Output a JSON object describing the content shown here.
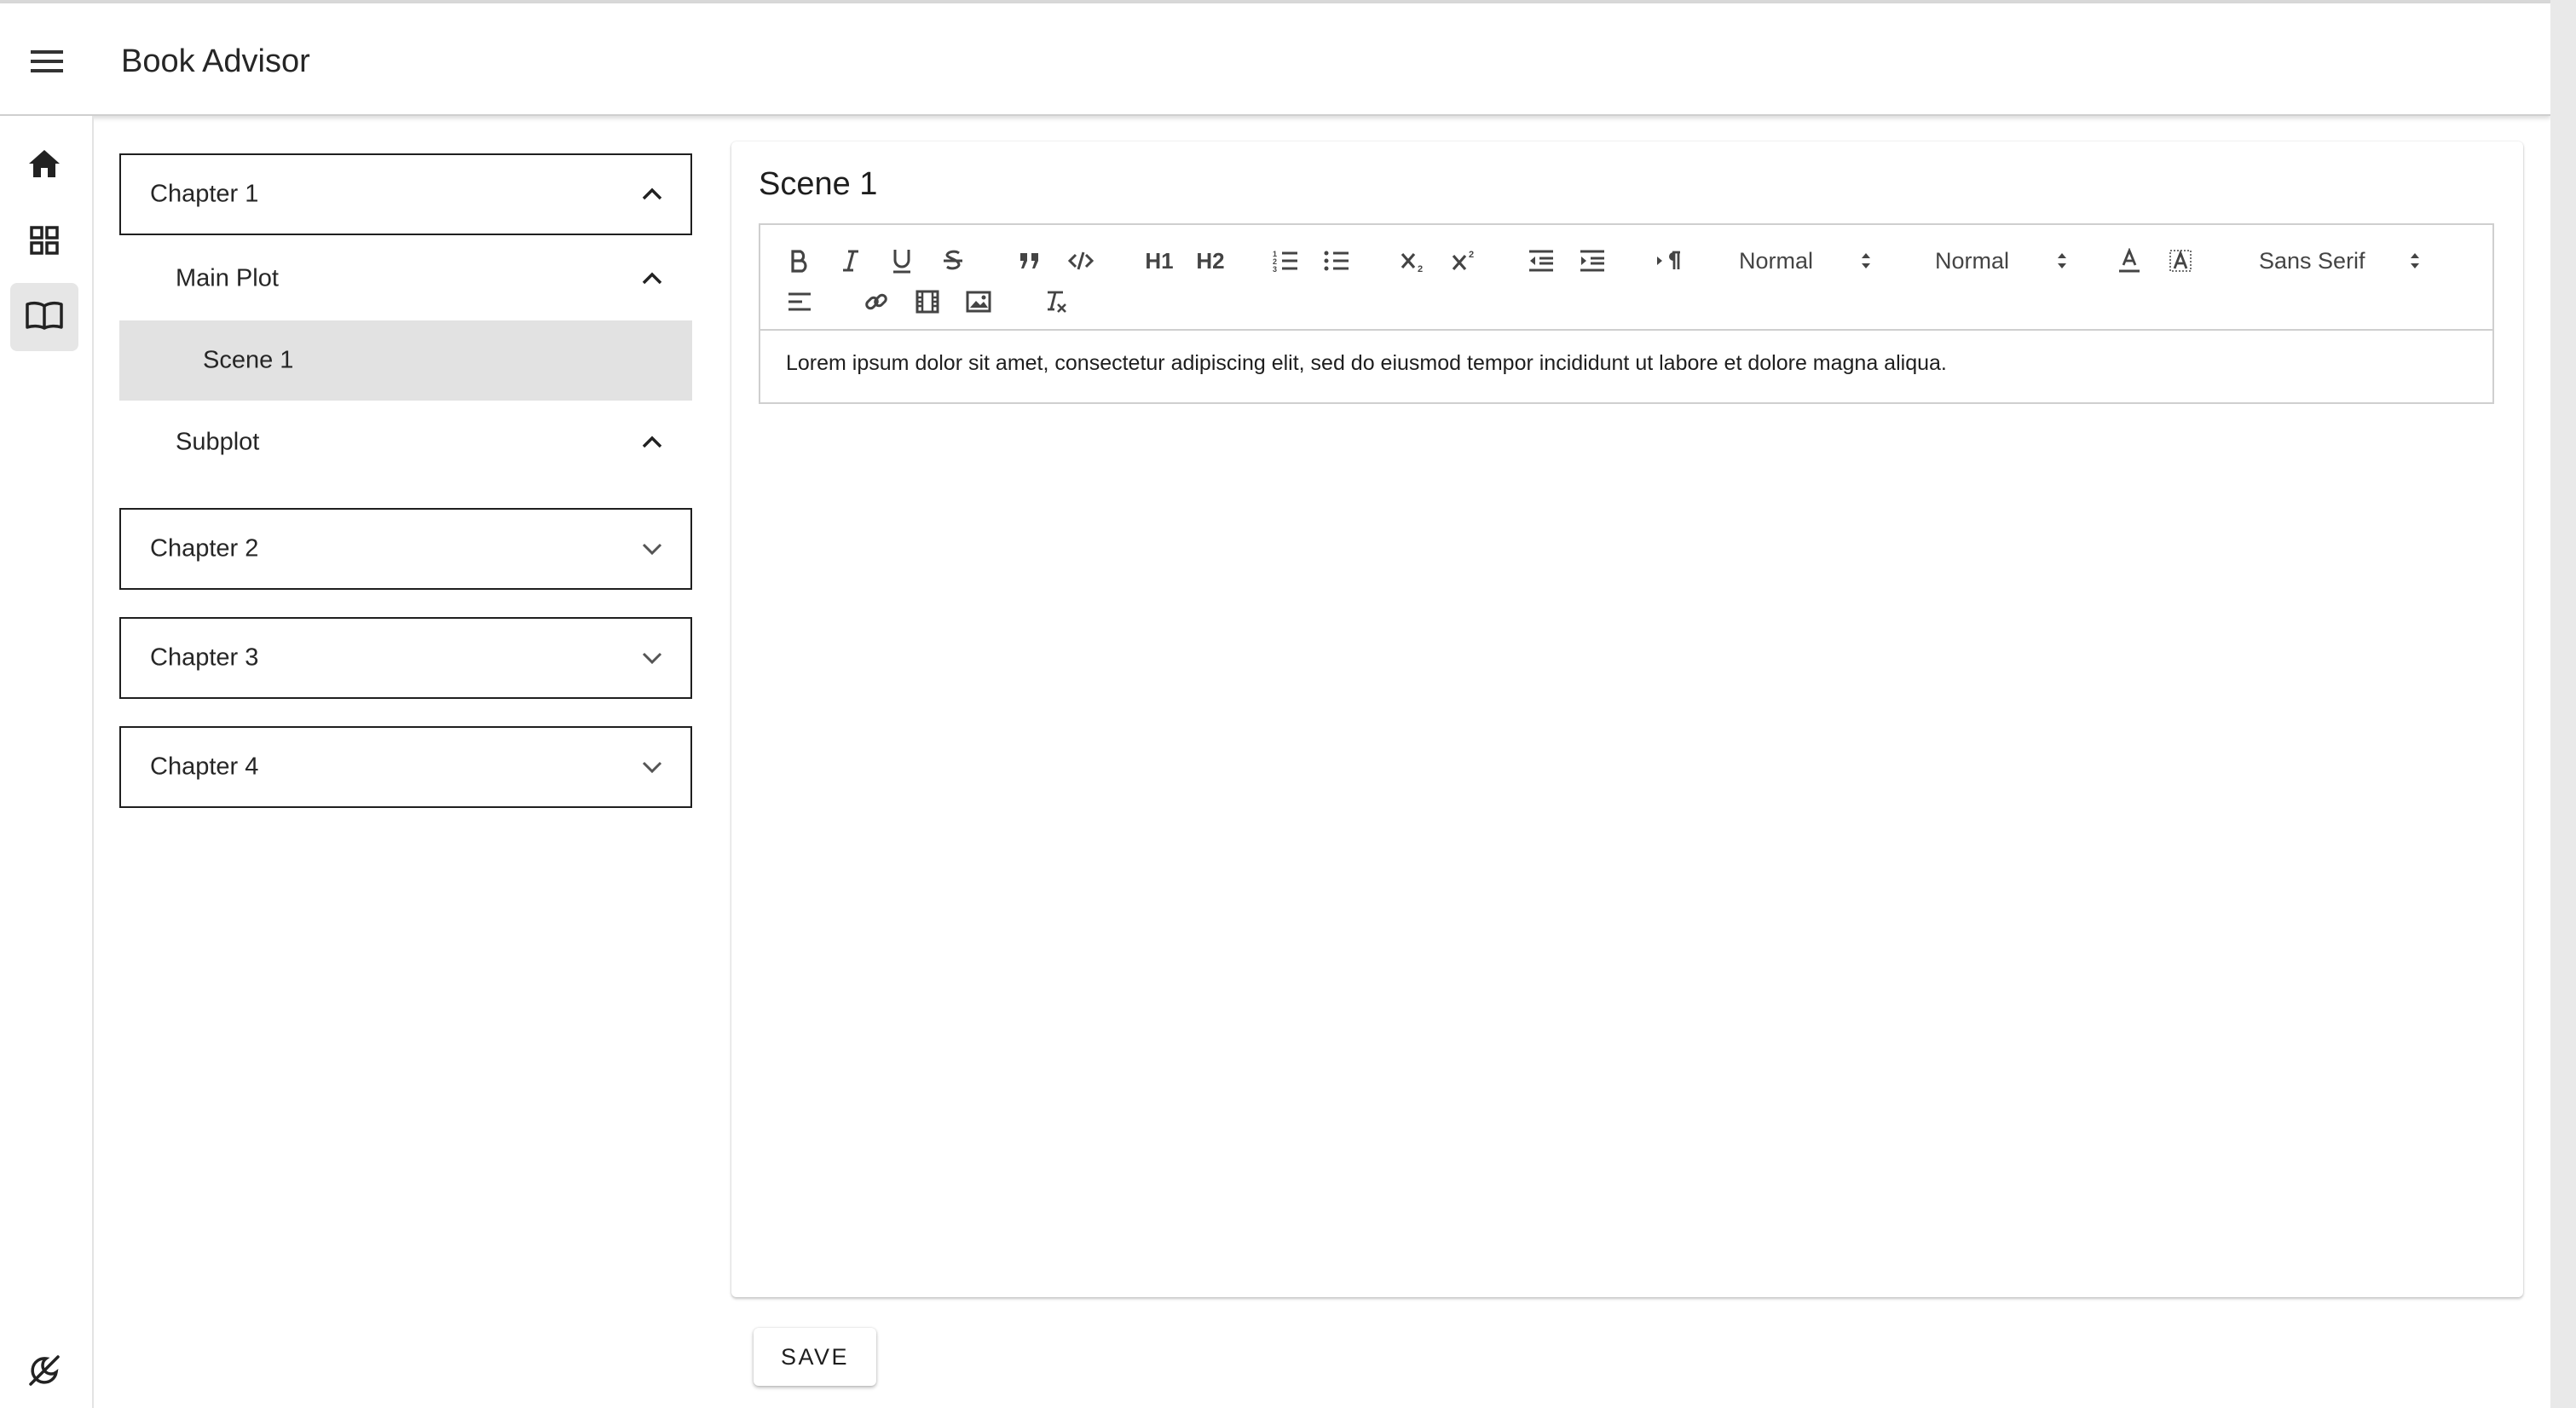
{
  "app": {
    "title": "Book Advisor"
  },
  "icons": {
    "menu": "menu-icon",
    "home": "home-icon",
    "dashboard": "dashboard-icon",
    "book": "book-icon",
    "theme": "theme-toggle-icon"
  },
  "nav": {
    "chapters": [
      {
        "label": "Chapter 1",
        "expanded": true
      },
      {
        "label": "Chapter 2",
        "expanded": false
      },
      {
        "label": "Chapter 3",
        "expanded": false
      },
      {
        "label": "Chapter 4",
        "expanded": false
      }
    ],
    "plots": [
      {
        "label": "Main Plot",
        "expanded": true
      },
      {
        "label": "Subplot",
        "expanded": true
      }
    ],
    "scenes": [
      {
        "label": "Scene 1",
        "selected": true
      }
    ]
  },
  "editor": {
    "title": "Scene 1",
    "toolbar": {
      "header_select": "Normal",
      "size_select": "Normal",
      "font_select": "Sans Serif",
      "h1": "H1",
      "h2": "H2"
    },
    "content": "Lorem ipsum dolor sit amet, consectetur adipiscing elit, sed do eiusmod tempor incididunt ut labore et dolore magna aliqua."
  },
  "actions": {
    "save_label": "SAVE"
  },
  "colors": {
    "accent_selected": "#e2e2e2",
    "text": "#1e1e1e",
    "border": "#1f1f1f"
  }
}
